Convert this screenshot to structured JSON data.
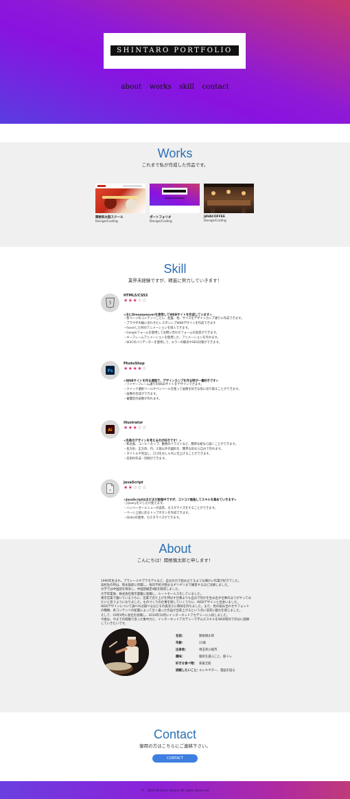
{
  "header": {
    "logo_text": "SHINTARO PORTFOLIO",
    "nav": [
      "about",
      "works",
      "skill",
      "contact"
    ]
  },
  "works": {
    "title": "Works",
    "subtitle": "これまで私が作成した作品です。",
    "items": [
      {
        "name": "関根和太鼓スクール",
        "category": "Design/Coding"
      },
      {
        "name": "ポートフォリオ",
        "category": "Design/Coding"
      },
      {
        "name": "JAVACOFFEE",
        "category": "Design/Coding"
      }
    ]
  },
  "skill": {
    "title": "Skill",
    "subtitle": "業界未経験ですが、精進に努力していきます！",
    "items": [
      {
        "name": "HTML5/CSS3",
        "icon": "html5-icon",
        "rating": 3,
        "stars_filled": "★★★",
        "stars_empty": "☆☆",
        "heading": "<主にDreamweaverを使用してWEBサイトを作成しています>",
        "points": [
          "・各ページのコンテンツごとに、配置、色、サイズをデザインカンプ通りに作成できます。",
          "・ブラウザの幅に合わせたレスポンシブWEBデザインを作成できます",
          "・hoverした時のアニメーションを導入できます。",
          "・Googleフォームを使用してお問い合わせフォームの実装ができます。",
          "・キーフレームアニメーションを使用した、アニメーションを作れます。",
          "・W3Cのバリデーターを使用して、エラーの解決やSEO対策ができます。"
        ]
      },
      {
        "name": "PhotoShop",
        "icon": "photoshop-icon",
        "rating": 4,
        "stars_filled": "★★★★",
        "stars_empty": "☆",
        "heading": "<WEBサイトを作る過程で、デザインカンプを作る時が一番好きです>",
        "points": [
          "・ワイヤーフレーム通りのWEBサイトをデザインできます。",
          "・クイック選択ツールやペンツールを使って画像を好きな形に切り取ることができます。",
          "・画像の合成ができます。",
          "・複層型の画像が作れます。"
        ]
      },
      {
        "name": "Illustrator",
        "icon": "illustrator-icon",
        "rating": 3,
        "stars_filled": "★★★",
        "stars_empty": "☆☆",
        "heading": "<名刺のデザインを考えるのが好きです！>",
        "points": [
          "・和太鼓、コーヒーカップ、動物のイラストなど、簡単な絵なら描くことができます。",
          "・長方形、正方形、円、三角以外の図形を、簡単な形なら自分で作れます。",
          "・タイトルや見出し、ロゴをおしゃれに仕上げることができます。",
          "・名刺の作成・印刷ができます。"
        ]
      },
      {
        "name": "JavaScript",
        "icon": "javascript-icon",
        "rating": 2,
        "stars_filled": "★★",
        "stars_empty": "☆☆☆",
        "heading": "<JavaScriptはまだまだ勉強中ですが、コツコツ勉強してスキルを高めていきます>",
        "points": [
          "・jQueryを少しだけ使えます。",
          "・ハンバーガーメニューの実装、カスタマイズをすることができます。",
          "・ページ上部に戻るトップボタンを作成できます。",
          "・Sliderの使用、カスタマイズができます。"
        ]
      }
    ]
  },
  "about": {
    "title": "About",
    "subtitle": "こんにちは！関根慎太郎と申します！",
    "paragraphs": [
      "1990年生まれ。ブラレールやプラモデルなど、自分の力で組み立てるような細かい作業が好きでした。",
      "高校生の時は、和太鼓部に所属し、毎日学校が閉まるギリギリまで練習するほど没頭しました。",
      "大学では中国語を専攻し、中国語検定4級を取得しました。",
      "大学卒業後、株式会社東京書籍に就職し、ルートセールスをしていました。",
      "東京営業で働いているうちに、営業で売り上げを伸ばす仕事よりも自分で何かを生み出す仕事のほうがやってみ",
      "たいと思うようになりました。ものづくりの仕事を探していくうちに、WEBデザインと出会いました。",
      "WEBデザインについて調べれば調べるほどその奥深さに興味を持ちました。また、色の組み合わせやフォント",
      "の種類、各コンテンツの配置によって全く違った作品が出来上がるという点に非常に魅力を感じました。",
      "そして、19年9月に会社を退職し、2019年10月にインターネットアカデミーに入校しました。",
      "今後は、今までの経験で培った集中力と、インターネットアカデミーで学んだスキルをWEB制作で存分に発揮",
      "していきたいです。"
    ],
    "profile": [
      {
        "key": "名前：",
        "value": "関根慎太郎"
      },
      {
        "key": "年齢：",
        "value": "23歳"
      },
      {
        "key": "出身地：",
        "value": "埼玉県川越市"
      },
      {
        "key": "趣味：",
        "value": "服装を選ぶこと、筋トレ"
      },
      {
        "key": "好きな食べ物：",
        "value": "家畜全般"
      },
      {
        "key": "挑戦したいこと：",
        "value": "エレキギター、漫画を描る"
      }
    ]
  },
  "contact": {
    "title": "Contact",
    "subtitle": "御用の方はこちらにご連絡下さい。",
    "button_label": "CONTACT"
  },
  "footer": {
    "copyright": "©　2020 Shintaro Sekine All rights Reserved"
  },
  "colors": {
    "accent_blue": "#2a6fb4",
    "star_pink": "#d5377a",
    "button_blue": "#3f7fe0"
  }
}
